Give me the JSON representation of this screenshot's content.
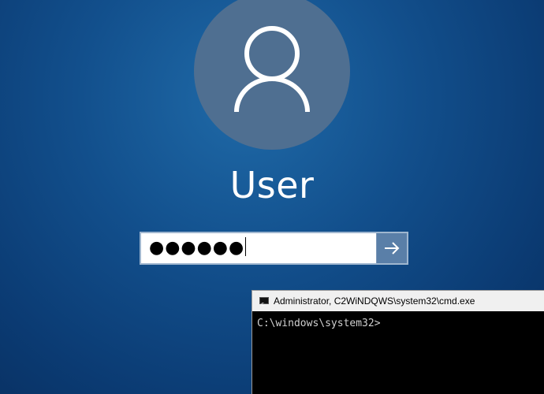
{
  "login": {
    "avatar_icon": "user-silhouette-icon",
    "username": "User",
    "password_masked": "●●●●●●",
    "submit_icon": "arrow-right-icon"
  },
  "cmd": {
    "icon": "cmd-console-icon",
    "icon_glyph": "c",
    "title": "Administrator, C2WiNDQWS\\system32\\cmd.exe",
    "prompt": "C:\\windows\\system32>"
  },
  "colors": {
    "background": "#124f8c",
    "avatar_circle": "#4f6f91",
    "submit_button": "#5a7fa8",
    "cmd_background": "#000000",
    "cmd_titlebar": "#f0f0f0"
  }
}
